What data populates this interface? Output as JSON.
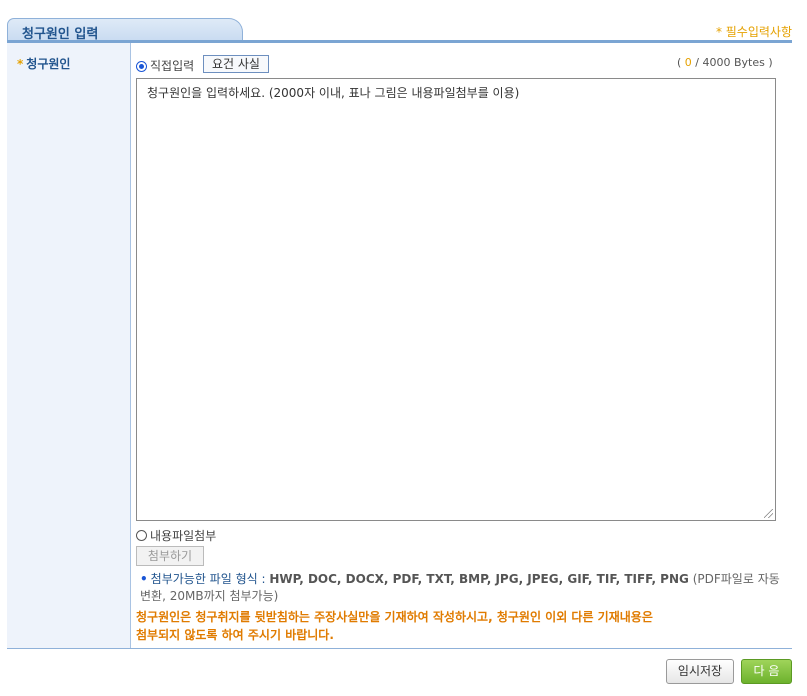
{
  "header": {
    "title": "청구원인 입력",
    "required_note": "* 필수입력사항"
  },
  "form": {
    "field_label": "청구원인",
    "field_star": "*",
    "direct_input_label": "직접입력",
    "requirement_button": "요건 사실",
    "bytes": {
      "open": "( ",
      "current": "0",
      "rest": " / 4000 Bytes )"
    },
    "textarea_placeholder": "청구원인을 입력하세요. (2000자 이내, 표나 그림은 내용파일첨부를 이용)",
    "file_attach_label": "내용파일첨부",
    "attach_button": "첨부하기",
    "formats_label": "첨부가능한 파일 형식 :",
    "formats_types": "HWP, DOC, DOCX, PDF, TXT, BMP, JPG, JPEG, GIF, TIF, TIFF, PNG",
    "formats_note": "(PDF파일로 자동변환, 20MB까지 첨부가능)",
    "warning_line1": "청구원인은 청구취지를 뒷받침하는 주장사실만을 기재하여 작성하시고, 청구원인 이외 다른 기재내용은",
    "warning_line2": "첨부되지 않도록 하여 주시기 바랍니다."
  },
  "footer": {
    "temp_save": "임시저장",
    "next": "다 음"
  }
}
